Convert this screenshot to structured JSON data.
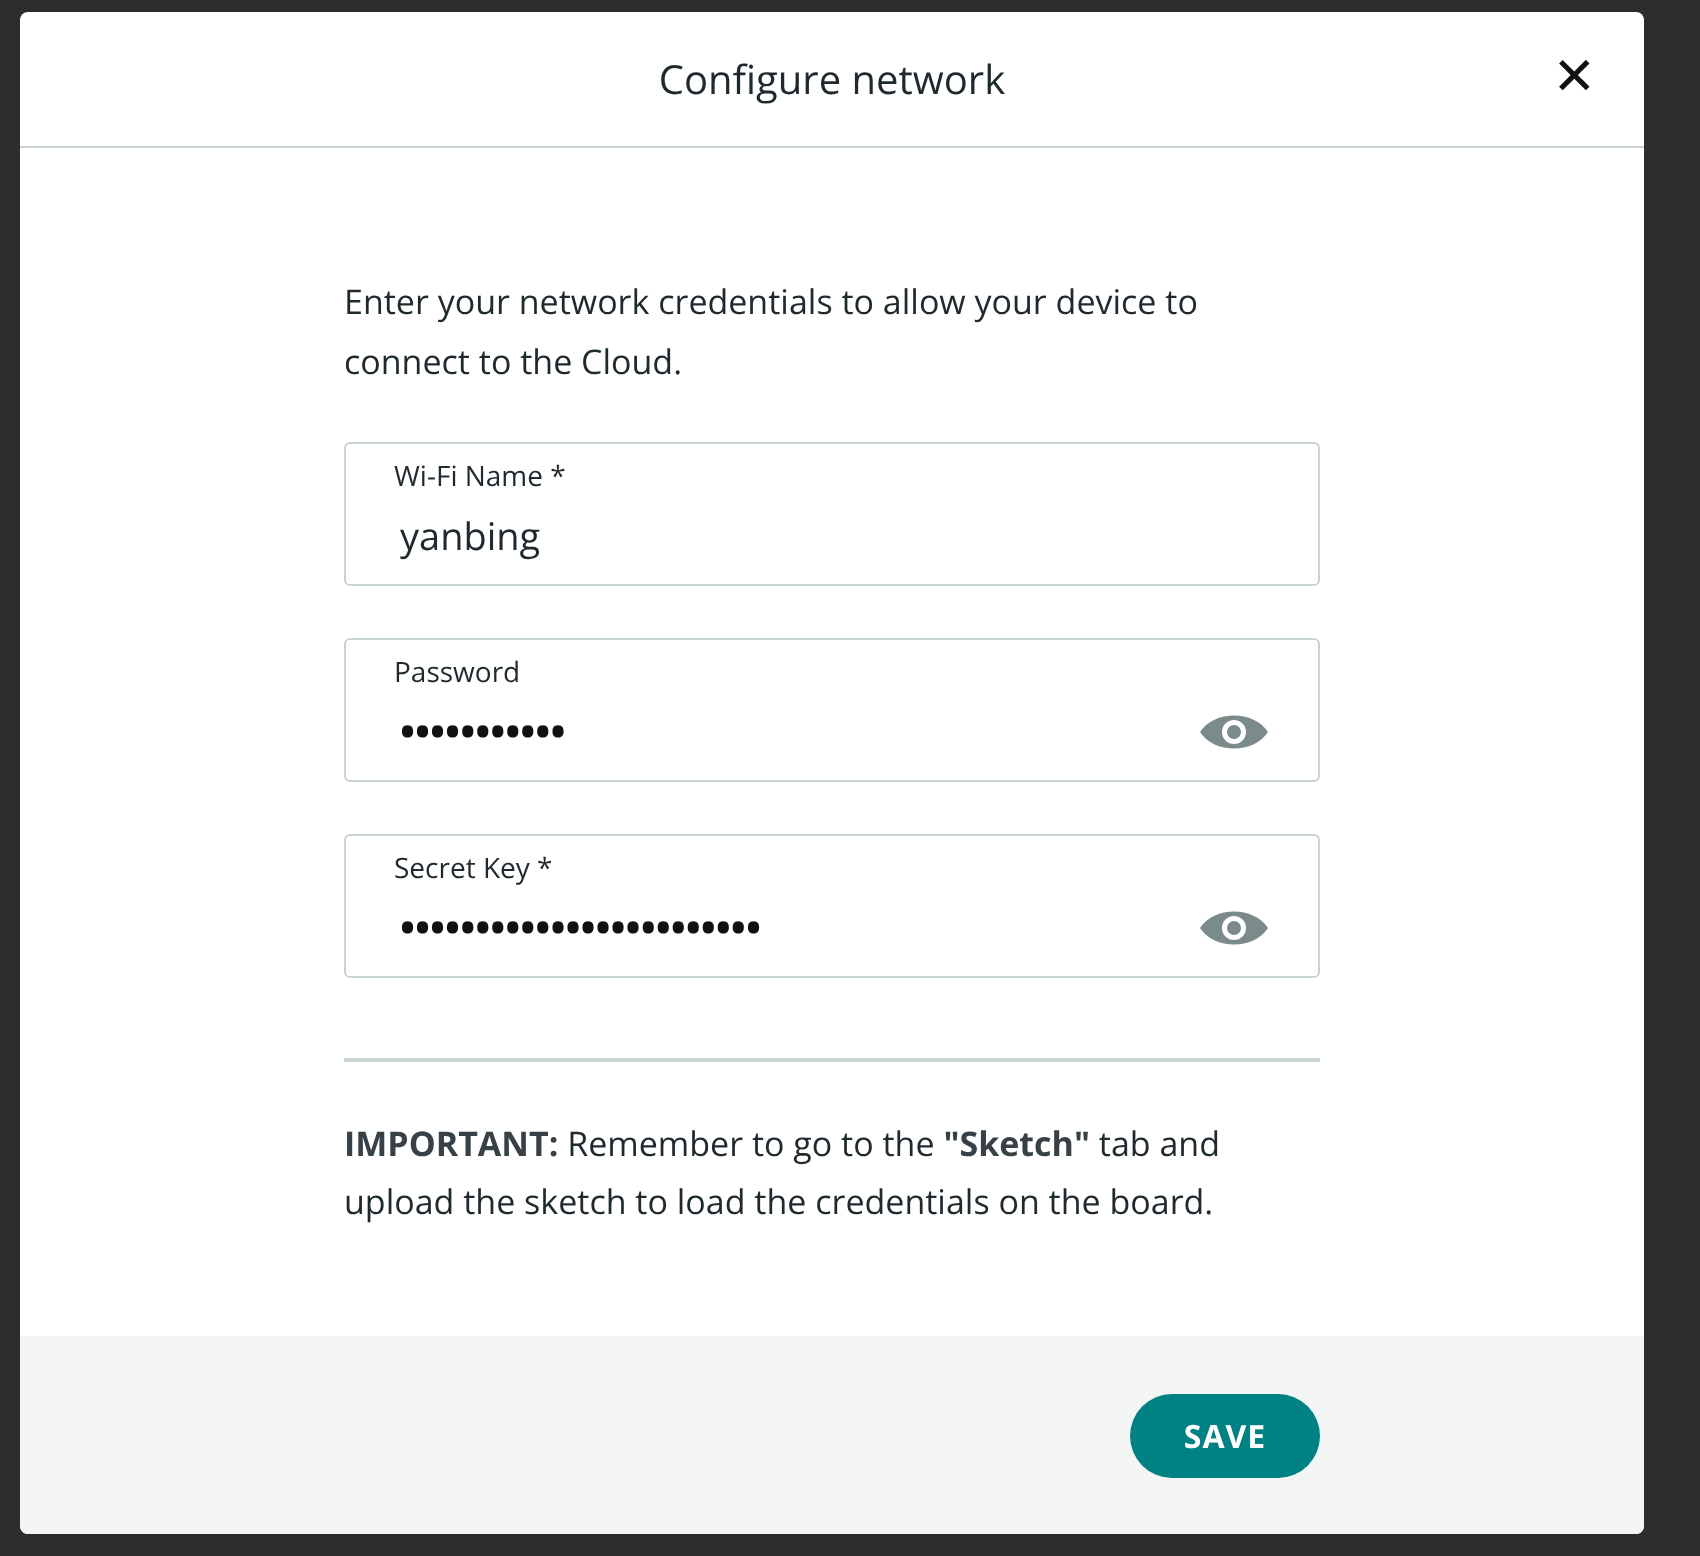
{
  "dialog": {
    "title": "Configure network",
    "close": "✕"
  },
  "intro": "Enter your network credentials to allow your device to connect to the Cloud.",
  "fields": [
    {
      "kind": "text",
      "label": "Wi-Fi Name *",
      "value": "yanbing"
    },
    {
      "kind": "password",
      "label": "Password",
      "value": "•••••••••••"
    },
    {
      "kind": "password",
      "label": "Secret Key *",
      "value": "••••••••••••••••••••••••"
    }
  ],
  "note": "**IMPORTANT:** Remember to go to the **\"Sketch\"** tab and upload the sketch to load the credentials on the board.",
  "buttons": [
    "SAVE"
  ]
}
